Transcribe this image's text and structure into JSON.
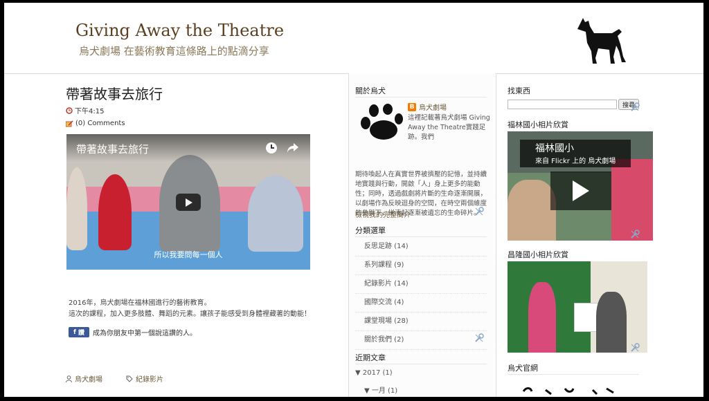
{
  "header": {
    "title": "Giving Away the Theatre",
    "description": "烏犬劇場 在藝術教育這條路上的點滴分享"
  },
  "post": {
    "title": "帶著故事去旅行",
    "time": "下午4:15",
    "comments": "(0) Comments",
    "video_title": "帶著故事去旅行",
    "video_caption": "所以我要問每一個人",
    "body_lines": [
      "2016年，烏犬劇場在福林國進行的藝術教育。",
      "這次的課程，加入更多肢體、舞蹈的元素。讓孩子能感受到身體裡藏著的動能！"
    ],
    "fb_button": "讚",
    "fb_text": "成為你朋友中第一個說這讚的人。",
    "author": "烏犬劇場",
    "label": "紀錄影片"
  },
  "sidebar1": {
    "about_title": "關於烏犬",
    "profile_name": "烏犬劇場",
    "about_head": "這裡記載著烏犬劇場 Giving Away the Theatre實踐足跡。我們",
    "about_text": "期待喚起人在真實世界被擠壓的記憶，並持續地實踐與行動，開啟「人」身上更多的能動性；同時，透過戲劇將片斷的生命逐漸開展，以劇場作為反映迴身的空間，在時空兩個維度的參與下，拼湊起逐漸被遺忘的生命碎片。",
    "profile_link": "檢視我的完整簡介",
    "categories_title": "分類選單",
    "categories": [
      "反思足跡 (14)",
      "系列課程 (9)",
      "紀錄影片 (14)",
      "國際交流 (4)",
      "課堂現場 (28)",
      "關於我們 (2)"
    ],
    "archive_title": "近期文章",
    "archive_year": "▼ 2017 (1)",
    "archive_month": "▼ 一月 (1)"
  },
  "sidebar2": {
    "search_title": "找東西",
    "search_button": "搜尋",
    "flickr1_title": "福林國小相片欣賞",
    "flickr1_line1": "福林國小",
    "flickr1_line2": "來自 Flickr 上的 烏犬劇場",
    "flickr2_title": "昌隆國小相片欣賞",
    "official_title": "烏犬官網"
  },
  "colors": {
    "title_brown": "#5b3f1f",
    "facebook": "#3b5998"
  }
}
